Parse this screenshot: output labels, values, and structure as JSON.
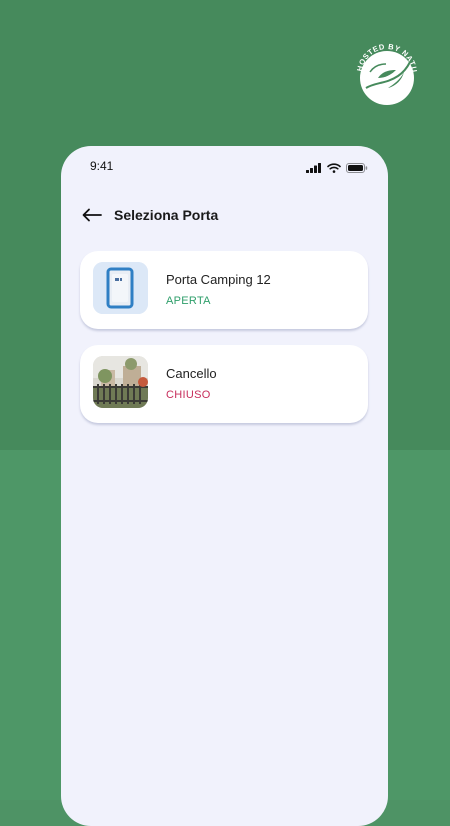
{
  "brand": {
    "logo_text": "HOSTED BY NATURE"
  },
  "status_bar": {
    "time": "9:41"
  },
  "header": {
    "title": "Seleziona Porta"
  },
  "doors": [
    {
      "name": "Porta Camping 12",
      "status": "APERTA",
      "status_color": "#2e9e6a",
      "thumb": "door-lock-device"
    },
    {
      "name": "Cancello",
      "status": "CHIUSO",
      "status_color": "#c72e5c",
      "thumb": "gate-photo"
    }
  ],
  "colors": {
    "background": "#468a5c",
    "screen": "#f1f2fc",
    "card": "#ffffff"
  }
}
